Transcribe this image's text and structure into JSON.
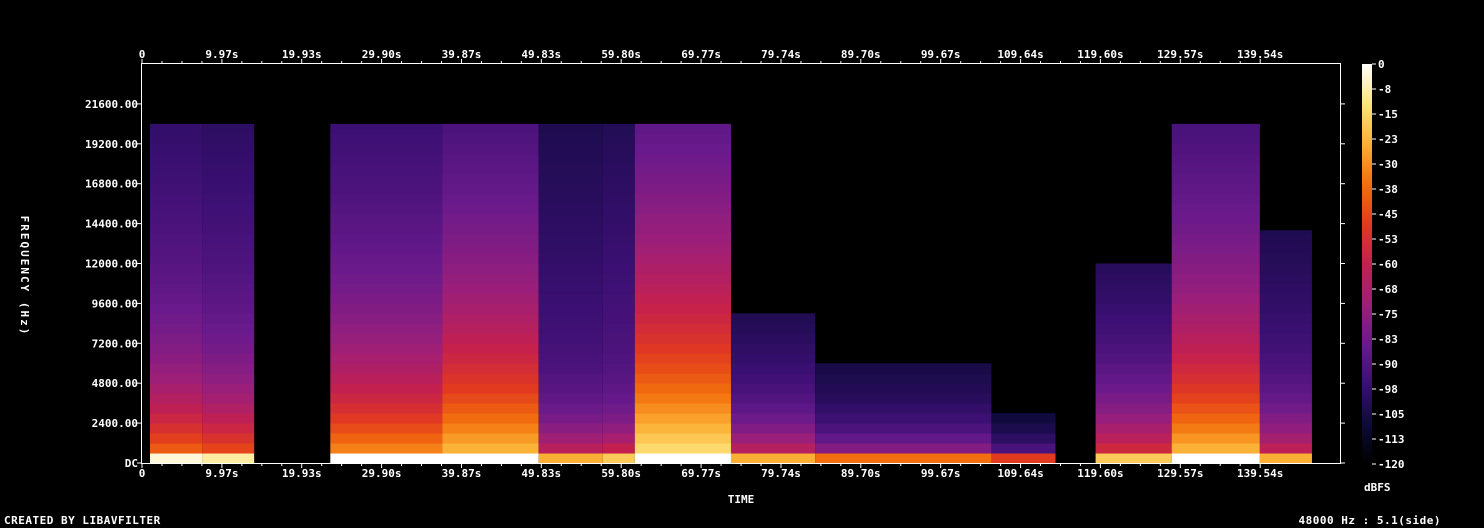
{
  "chart_data": {
    "type": "heatmap",
    "title": "",
    "xlabel": "TIME",
    "ylabel": "FREQUENCY (Hz)",
    "x_ticks": [
      "0",
      "9.97s",
      "19.93s",
      "29.90s",
      "39.87s",
      "49.83s",
      "59.80s",
      "69.77s",
      "79.74s",
      "89.70s",
      "99.67s",
      "109.64s",
      "119.60s",
      "129.57s",
      "139.54s"
    ],
    "x_tick_values": [
      0,
      9.97,
      19.93,
      29.9,
      39.87,
      49.83,
      59.8,
      69.77,
      79.74,
      89.7,
      99.67,
      109.64,
      119.6,
      129.57,
      139.54
    ],
    "xlim": [
      0,
      149.5
    ],
    "y_ticks": [
      "DC",
      "2400.00",
      "4800.00",
      "7200.00",
      "9600.00",
      "12000.00",
      "14400.00",
      "16800.00",
      "19200.00",
      "21600.00"
    ],
    "y_tick_values": [
      0,
      2400,
      4800,
      7200,
      9600,
      12000,
      14400,
      16800,
      19200,
      21600
    ],
    "ylim": [
      0,
      24000
    ],
    "colorbar": {
      "label": "dBFS",
      "ticks": [
        "0",
        "-8",
        "-15",
        "-23",
        "-30",
        "-38",
        "-45",
        "-53",
        "-60",
        "-68",
        "-75",
        "-83",
        "-90",
        "-98",
        "-105",
        "-113",
        "-120"
      ],
      "range": [
        -120,
        0
      ],
      "colors": [
        "#000000",
        "#0d0a3a",
        "#3a0f72",
        "#6a1a8c",
        "#9b1f7a",
        "#c4204f",
        "#e23a1f",
        "#f36f0d",
        "#fbb033",
        "#fde47c",
        "#ffffff"
      ]
    },
    "segments": [
      {
        "start": 1.0,
        "end": 7.5,
        "top_hz": 20400,
        "intensity": 0.72,
        "rolloff_hz": 2400
      },
      {
        "start": 7.5,
        "end": 14.0,
        "top_hz": 20400,
        "intensity": 0.68,
        "rolloff_hz": 2200
      },
      {
        "start": 23.5,
        "end": 37.5,
        "top_hz": 20400,
        "intensity": 0.78,
        "rolloff_hz": 3000
      },
      {
        "start": 37.5,
        "end": 49.5,
        "top_hz": 20400,
        "intensity": 0.85,
        "rolloff_hz": 4500
      },
      {
        "start": 49.5,
        "end": 57.5,
        "top_hz": 20400,
        "intensity": 0.55,
        "rolloff_hz": 1200
      },
      {
        "start": 57.5,
        "end": 61.5,
        "top_hz": 20400,
        "intensity": 0.6,
        "rolloff_hz": 1000
      },
      {
        "start": 61.5,
        "end": 73.5,
        "top_hz": 20400,
        "intensity": 0.92,
        "rolloff_hz": 6000
      },
      {
        "start": 73.5,
        "end": 84.0,
        "top_hz": 9000,
        "intensity": 0.55,
        "rolloff_hz": 1200
      },
      {
        "start": 84.0,
        "end": 106.0,
        "top_hz": 6000,
        "intensity": 0.45,
        "rolloff_hz": 800
      },
      {
        "start": 106.0,
        "end": 114.0,
        "top_hz": 3000,
        "intensity": 0.35,
        "rolloff_hz": 500
      },
      {
        "start": 119.0,
        "end": 128.5,
        "top_hz": 12000,
        "intensity": 0.6,
        "rolloff_hz": 1800
      },
      {
        "start": 128.5,
        "end": 139.5,
        "top_hz": 20400,
        "intensity": 0.85,
        "rolloff_hz": 4000
      },
      {
        "start": 139.5,
        "end": 146.0,
        "top_hz": 14000,
        "intensity": 0.55,
        "rolloff_hz": 1500
      }
    ]
  },
  "footer": {
    "left": "CREATED BY LIBAVFILTER",
    "right": "48000 Hz : 5.1(side)"
  }
}
